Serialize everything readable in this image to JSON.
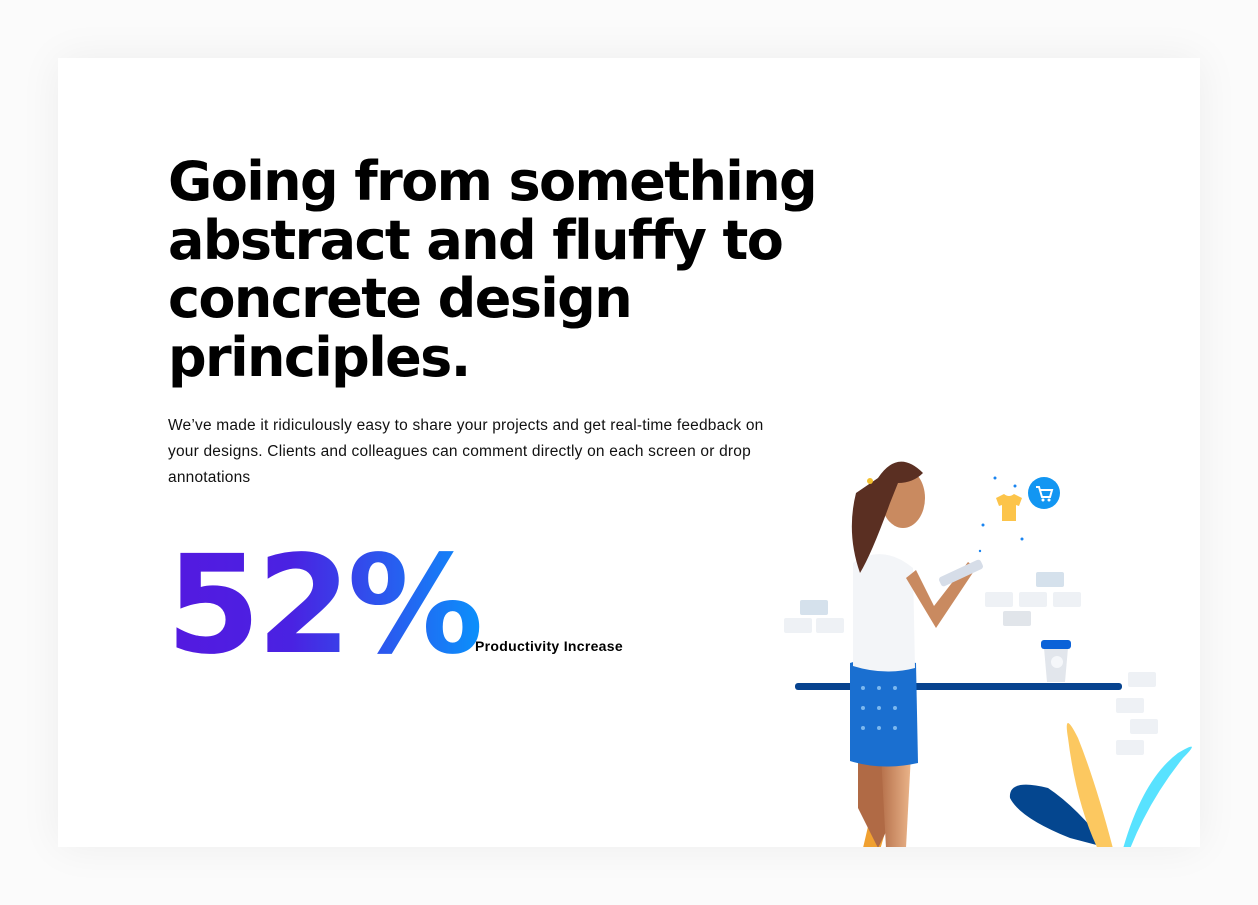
{
  "hero": {
    "title": "Going from something abstract and fluffy to concrete design principles.",
    "description": "We’ve made it ridiculously easy to share your projects and get real-time feedback on your designs. Clients and colleagues can comment directly on each screen or drop annotations"
  },
  "stat": {
    "value": "52%",
    "label": "Productivity Increase",
    "gradient": [
      "#5419e0",
      "#0b90fb"
    ]
  },
  "illustration": {
    "icons": [
      "woman-with-tablet",
      "shopping-cart-icon",
      "tshirt-icon",
      "coffee-cup",
      "plant"
    ]
  }
}
